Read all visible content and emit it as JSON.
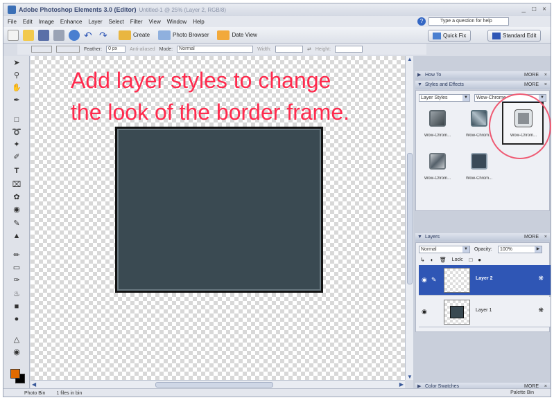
{
  "window": {
    "title_app": "Adobe Photoshop Elements 3.0 (Editor)",
    "title_doc": "Untitled-1 @ 25% (Layer 2, RGB/8)",
    "controls": [
      "_",
      "□",
      "×"
    ]
  },
  "menubar": {
    "items": [
      "File",
      "Edit",
      "Image",
      "Enhance",
      "Layer",
      "Select",
      "Filter",
      "View",
      "Window",
      "Help"
    ],
    "help_placeholder": "Type a question for help"
  },
  "toolbar": {
    "create_label": "Create",
    "photo_browser_label": "Photo Browser",
    "date_view_label": "Date View",
    "quick_fix_label": "Quick Fix",
    "standard_edit_label": "Standard Edit"
  },
  "options_bar": {
    "feather_label": "Feather:",
    "feather_value": "0 px",
    "anti_aliased_label": "Anti-aliased",
    "mode_label": "Mode:",
    "mode_value": "Normal",
    "width_label": "Width:",
    "height_label": "Height:"
  },
  "canvas": {
    "annotation_line1": "Add layer styles to change",
    "annotation_line2": "the look of the border frame."
  },
  "panels": {
    "how_to_title": "How To",
    "more_label": "MORE",
    "styles_title": "Styles and Effects",
    "category_value": "Layer Styles",
    "library_value": "Wow-Chrome",
    "style_items": [
      "Wow-Chrom...",
      "Wow-Chrom...",
      "Wow-Chrom...",
      "Wow-Chrom...",
      "Wow-Chrom..."
    ],
    "layers_title": "Layers",
    "blend_mode": "Normal",
    "opacity_label": "Opacity:",
    "opacity_value": "100%",
    "lock_label": "Lock:",
    "layers": [
      {
        "name": "Layer 2"
      },
      {
        "name": "Layer 1"
      }
    ],
    "color_swatches_title": "Color Swatches"
  },
  "status": {
    "photo_bin_label": "Photo Bin",
    "files_in_bin": "1 files in bin",
    "palette_bin_label": "Palette Bin"
  },
  "colors": {
    "annotation": "#ff2a4d",
    "foreground_swatch": "#e06a00",
    "background_swatch": "#000000",
    "frame_fill": "#3a4a52",
    "layer_selected": "#2f56b5"
  }
}
